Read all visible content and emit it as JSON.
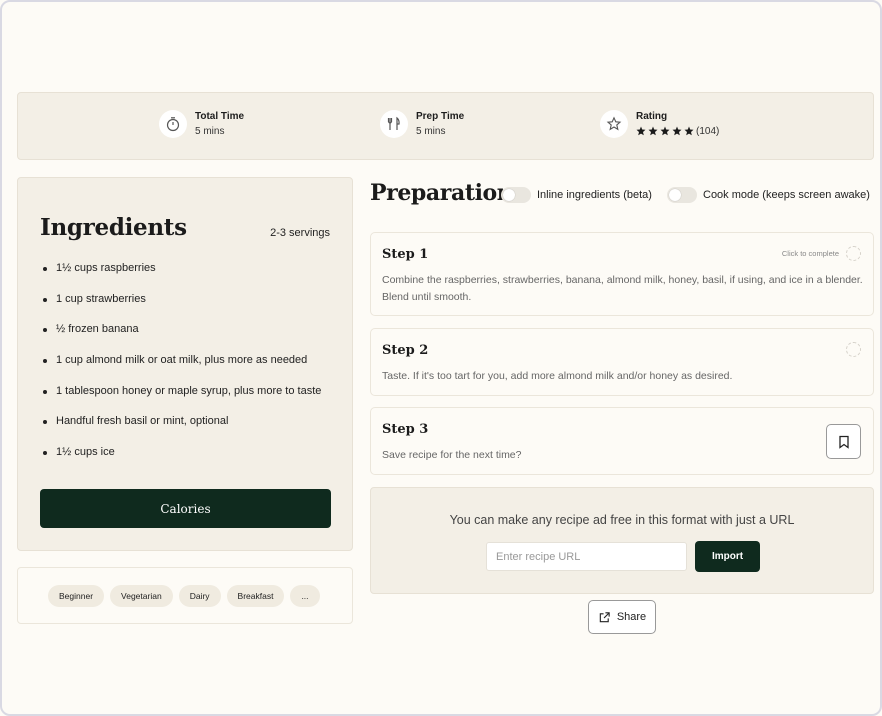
{
  "stats": [
    {
      "label": "Total Time",
      "value": "5 mins",
      "icon": "timer-icon"
    },
    {
      "label": "Prep Time",
      "value": "5 mins",
      "icon": "utensils-icon"
    },
    {
      "label": "Rating",
      "value": "(104)",
      "icon": "star-icon",
      "stars": 5
    }
  ],
  "ingredients": {
    "title": "Ingredients",
    "servings": "2-3 servings",
    "items": [
      "1½ cups raspberries",
      "1 cup strawberries",
      "½ frozen banana",
      "1 cup almond milk or oat milk, plus more as needed",
      "1 tablespoon honey or maple syrup, plus more to taste",
      "Handful fresh basil or mint, optional",
      "1½ cups ice"
    ],
    "calories_label": "Calories"
  },
  "tags": [
    "Beginner",
    "Vegetarian",
    "Dairy",
    "Breakfast",
    "..."
  ],
  "preparation": {
    "title": "Preparation",
    "toggle_inline": "Inline ingredients (beta)",
    "toggle_cook": "Cook mode (keeps screen awake)",
    "complete_hint": "Click to complete",
    "steps": [
      {
        "title": "Step 1",
        "text": "Combine the raspberries, strawberries, banana, almond milk, honey, basil, if using, and ice in a blender. Blend until smooth."
      },
      {
        "title": "Step 2",
        "text": "Taste. If it's too tart for you, add more almond milk and/or honey as desired."
      },
      {
        "title": "Step 3",
        "text": "Save recipe for the next time?"
      }
    ]
  },
  "import": {
    "message": "You can make any recipe ad free in this format with just a URL",
    "placeholder": "Enter recipe URL",
    "button": "Import"
  },
  "share": {
    "label": "Share"
  },
  "colors": {
    "accent_dark_green": "#0f2a1e",
    "panel_beige": "#f3efe6",
    "page_bg": "#fdfbf6"
  }
}
